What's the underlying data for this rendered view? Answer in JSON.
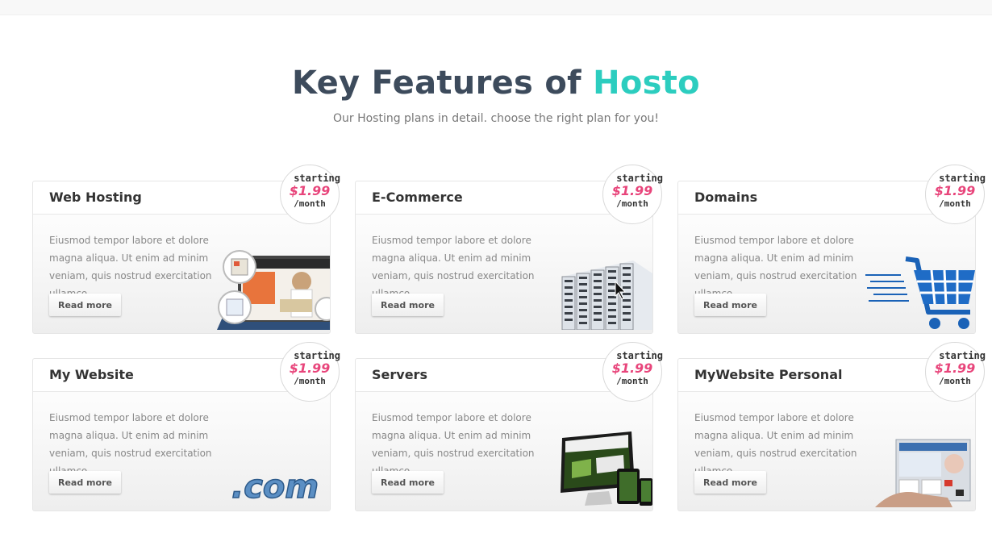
{
  "section": {
    "title_main": "Key Features of ",
    "title_accent": "Hosto",
    "subtitle": "Our Hosting plans in detail. choose the right plan for you!"
  },
  "colors": {
    "accent": "#2ccdbf",
    "price": "#e8457b",
    "heading": "#3d4b5c"
  },
  "cards": [
    {
      "title": "Web Hosting",
      "price_top": "starting",
      "price": "$1.99",
      "price_unit": "/month",
      "description": "Eiusmod tempor labore et dolore magna aliqua. Ut enim ad minim veniam, quis nostrud exercitation ullamco.",
      "button": "Read more",
      "icon": "laptop-website-icon"
    },
    {
      "title": "E-Commerce",
      "price_top": "starting",
      "price": "$1.99",
      "price_unit": "/month",
      "description": "Eiusmod tempor labore et dolore magna aliqua. Ut enim ad minim veniam, quis nostrud exercitation ullamco.",
      "button": "Read more",
      "icon": "server-rack-icon"
    },
    {
      "title": "Domains",
      "price_top": "starting",
      "price": "$1.99",
      "price_unit": "/month",
      "description": "Eiusmod tempor labore et dolore magna aliqua. Ut enim ad minim veniam, quis nostrud exercitation ullamco.",
      "button": "Read more",
      "icon": "shopping-cart-icon"
    },
    {
      "title": "My Website",
      "price_top": "starting",
      "price": "$1.99",
      "price_unit": "/month",
      "description": "Eiusmod tempor labore et dolore magna aliqua. Ut enim ad minim veniam, quis nostrud exercitation ullamco.",
      "button": "Read more",
      "icon": "dotcom-icon",
      "icon_text": ".com"
    },
    {
      "title": "Servers",
      "price_top": "starting",
      "price": "$1.99",
      "price_unit": "/month",
      "description": "Eiusmod tempor labore et dolore magna aliqua. Ut enim ad minim veniam, quis nostrud exercitation ullamco.",
      "button": "Read more",
      "icon": "responsive-devices-icon"
    },
    {
      "title": "MyWebsite Personal",
      "price_top": "starting",
      "price": "$1.99",
      "price_unit": "/month",
      "description": "Eiusmod tempor labore et dolore magna aliqua. Ut enim ad minim veniam, quis nostrud exercitation ullamco.",
      "button": "Read more",
      "icon": "website-screen-icon"
    }
  ]
}
